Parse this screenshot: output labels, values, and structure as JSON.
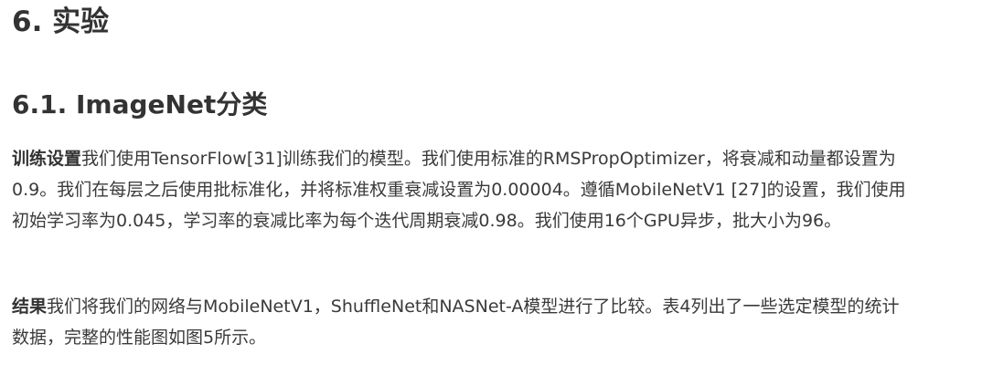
{
  "section": {
    "title": "6. 实验"
  },
  "subsection": {
    "title": "6.1. ImageNet分类"
  },
  "training": {
    "lead": "训练设置",
    "lines": [
      "我们使用TensorFlow[31]训练我们的模型。我们使用标准的RMSPropOptimizer，将衰减和动量都设置为",
      "0.9。我们在每层之后使用批标准化，并将标准权重衰减设置为0.00004。遵循MobileNetV1 [27]的设置，我们使用",
      "初始学习率为0.045，学习率的衰减比率为每个迭代周期衰减0.98。我们使用16个GPU异步，批大小为96。"
    ]
  },
  "results": {
    "lead": "结果",
    "lines": [
      "我们将我们的网络与MobileNetV1，ShuffleNet和NASNet-A模型进行了比较。表4列出了一些选定模型的统计",
      "数据，完整的性能图如图5所示。"
    ]
  }
}
